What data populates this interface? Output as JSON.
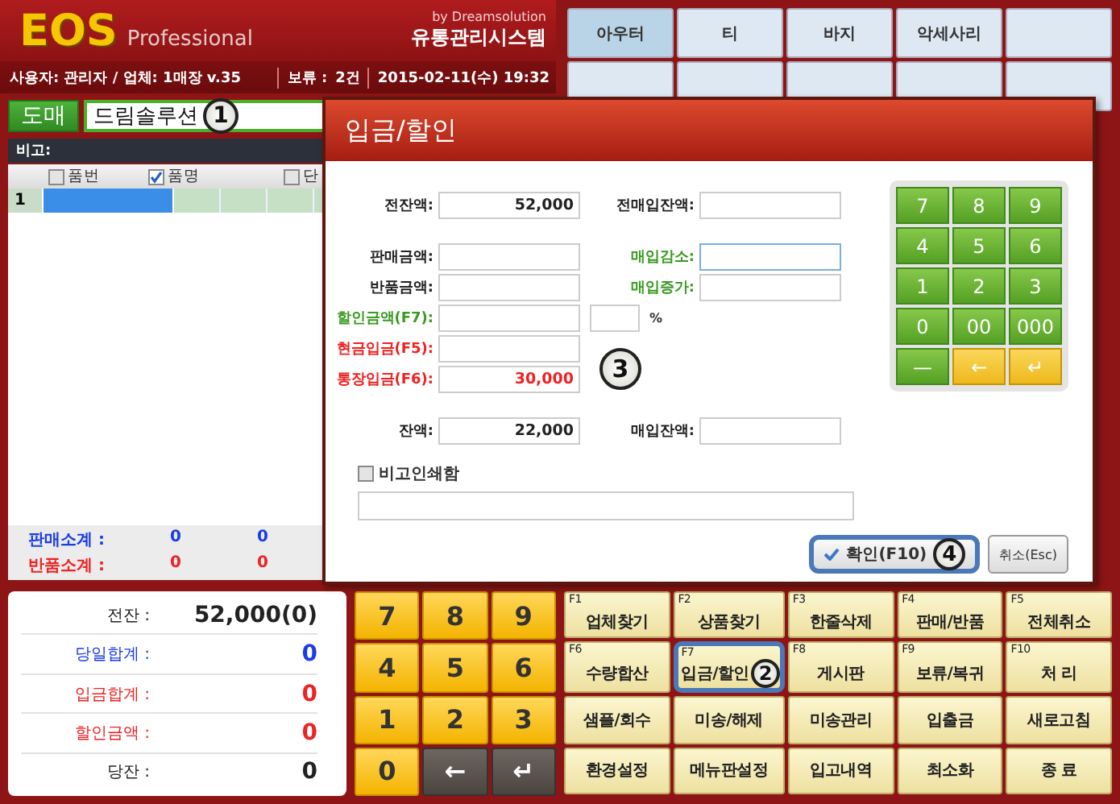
{
  "header": {
    "logo": "EOS",
    "edition": "Professional",
    "vendor": "by Dreamsolution",
    "system": "유통관리시스템",
    "user": "사용자: 관리자 / 업체: 1매장 v.35",
    "hold_label": "보류 :",
    "hold_count": "2건",
    "datetime": "2015-02-11(수) 19:32"
  },
  "categories": [
    {
      "label": "아우터",
      "selected": true
    },
    {
      "label": "티",
      "selected": false
    },
    {
      "label": "바지",
      "selected": false
    },
    {
      "label": "악세사리",
      "selected": false
    }
  ],
  "sale": {
    "mode_button": "도매",
    "customer": "드림솔루션",
    "customer_badge": "1",
    "note_label": "비고:",
    "columns": [
      {
        "label": "품번",
        "checked": false
      },
      {
        "label": "품명",
        "checked": true
      },
      {
        "label": "단",
        "checked": false
      }
    ],
    "rows": [
      {
        "number": "1",
        "selected": true
      }
    ],
    "subtotals": [
      {
        "label": "판매소계 :",
        "values": [
          "0",
          "0"
        ],
        "color": "#1a3ce6"
      },
      {
        "label": "반품소계 :",
        "values": [
          "0",
          "0"
        ],
        "color": "#ee2222"
      }
    ]
  },
  "summary": [
    {
      "label": "전잔 :",
      "value": "52,000(0)",
      "color": "#222222"
    },
    {
      "label": "당일합계 :",
      "value": "0",
      "color": "#1a3ce6"
    },
    {
      "label": "입금합계 :",
      "value": "0",
      "color": "#ee2222"
    },
    {
      "label": "할인금액 :",
      "value": "0",
      "color": "#ee2222"
    },
    {
      "label": "당잔 :",
      "value": "0",
      "color": "#222222"
    }
  ],
  "numpad": [
    {
      "label": "7",
      "kind": "digit"
    },
    {
      "label": "8",
      "kind": "digit"
    },
    {
      "label": "9",
      "kind": "digit"
    },
    {
      "label": "4",
      "kind": "digit"
    },
    {
      "label": "5",
      "kind": "digit"
    },
    {
      "label": "6",
      "kind": "digit"
    },
    {
      "label": "1",
      "kind": "digit"
    },
    {
      "label": "2",
      "kind": "digit"
    },
    {
      "label": "3",
      "kind": "digit"
    },
    {
      "label": "0",
      "kind": "digit"
    },
    {
      "label": "←",
      "kind": "nav"
    },
    {
      "label": "↵",
      "kind": "nav"
    }
  ],
  "functions": [
    {
      "key": "F1",
      "label": "업체찾기",
      "selected": false
    },
    {
      "key": "F2",
      "label": "상품찾기",
      "selected": false
    },
    {
      "key": "F3",
      "label": "한줄삭제",
      "selected": false
    },
    {
      "key": "F4",
      "label": "판매/반품",
      "selected": false
    },
    {
      "key": "F5",
      "label": "전체취소",
      "selected": false
    },
    {
      "key": "F6",
      "label": "수량합산",
      "selected": false
    },
    {
      "key": "F7",
      "label": "입금/할인",
      "selected": true,
      "badge": "2"
    },
    {
      "key": "F8",
      "label": "게시판",
      "selected": false
    },
    {
      "key": "F9",
      "label": "보류/복귀",
      "selected": false
    },
    {
      "key": "F10",
      "label": "처 리",
      "selected": false
    },
    {
      "label": "샘플/회수",
      "selected": false
    },
    {
      "label": "미송/해제",
      "selected": false
    },
    {
      "label": "미송관리",
      "selected": false
    },
    {
      "label": "입출금",
      "selected": false
    },
    {
      "label": "새로고침",
      "selected": false
    },
    {
      "label": "환경설정",
      "selected": false
    },
    {
      "label": "메뉴판설정",
      "selected": false
    },
    {
      "label": "입고내역",
      "selected": false
    },
    {
      "label": "최소화",
      "selected": false
    },
    {
      "label": "종 료",
      "selected": false
    }
  ],
  "dialog": {
    "title": "입금/할인",
    "badge": "3",
    "sections": [
      {
        "rows": [
          {
            "left": {
              "label": "전잔액:",
              "value": "52,000",
              "color": "#222222"
            },
            "right": {
              "kind": "field",
              "label": "전매입잔액:",
              "color": "#222222",
              "focused": false
            }
          }
        ]
      },
      {
        "rows": [
          {
            "left": {
              "label": "판매금액:",
              "color": "#222222"
            },
            "right": {
              "kind": "field",
              "label": "매입감소:",
              "color": "#3a9a22",
              "focused": true
            }
          },
          {
            "left": {
              "label": "반품금액:",
              "color": "#222222"
            },
            "right": {
              "kind": "field",
              "label": "매입증가:",
              "color": "#3a9a22",
              "focused": false
            }
          },
          {
            "left": {
              "label": "할인금액(F7):",
              "color": "#3a9a22"
            },
            "right": {
              "kind": "percent",
              "unit": "%"
            }
          },
          {
            "left": {
              "label": "현금입금(F5):",
              "color": "#ee2222"
            }
          },
          {
            "left": {
              "label": "통장입금(F6):",
              "value": "30,000",
              "color": "#ee2222"
            }
          }
        ]
      },
      {
        "rows": [
          {
            "left": {
              "label": "잔액:",
              "value": "22,000",
              "color": "#222222"
            },
            "right": {
              "kind": "field",
              "label": "매입잔액:",
              "color": "#222222",
              "focused": false
            }
          }
        ]
      }
    ],
    "print_note": {
      "label": "비고인쇄함",
      "checked": false
    },
    "keypad": [
      {
        "label": "7",
        "kind": "digit"
      },
      {
        "label": "8",
        "kind": "digit"
      },
      {
        "label": "9",
        "kind": "digit"
      },
      {
        "label": "4",
        "kind": "digit"
      },
      {
        "label": "5",
        "kind": "digit"
      },
      {
        "label": "6",
        "kind": "digit"
      },
      {
        "label": "1",
        "kind": "digit"
      },
      {
        "label": "2",
        "kind": "digit"
      },
      {
        "label": "3",
        "kind": "digit"
      },
      {
        "label": "0",
        "kind": "digit"
      },
      {
        "label": "00",
        "kind": "digit"
      },
      {
        "label": "000",
        "kind": "digit"
      },
      {
        "label": "—",
        "kind": "digit"
      },
      {
        "label": "←",
        "kind": "action"
      },
      {
        "label": "↵",
        "kind": "action"
      }
    ],
    "buttons": [
      {
        "label": "확인(F10)",
        "kind": "confirm",
        "focused": true,
        "badge": "4"
      },
      {
        "label": "취소(Esc)",
        "kind": "cancel",
        "focused": false
      }
    ]
  }
}
